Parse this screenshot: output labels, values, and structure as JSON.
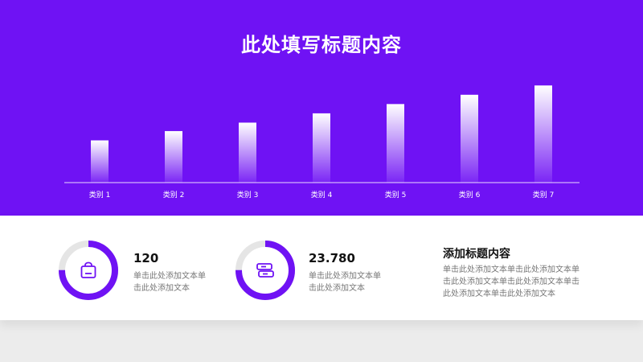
{
  "title": "此处填写标题内容",
  "colors": {
    "primary": "#6f12f4",
    "ring_track": "#e5e5e5",
    "text_dark": "#111111",
    "text_muted": "#777777"
  },
  "chart_data": {
    "type": "bar",
    "categories": [
      "类别 1",
      "类别 2",
      "类别 3",
      "类别 4",
      "类别 5",
      "类别 6",
      "类别 7"
    ],
    "values": [
      50,
      61,
      71,
      82,
      93,
      104,
      115
    ],
    "ylim": [
      0,
      120
    ],
    "grid": false
  },
  "stats": [
    {
      "value": "120",
      "desc": "单击此处添加文本单击此处添加文本",
      "icon": "shopping-bag-icon",
      "progress": 0.75
    },
    {
      "value": "23.780",
      "desc": "单击此处添加文本单击此处添加文本",
      "icon": "books-icon",
      "progress": 0.75
    }
  ],
  "side": {
    "title": "添加标题内容",
    "body": "单击此处添加文本单击此处添加文本单击此处添加文本单击此处添加文本单击此处添加文本单击此处添加文本"
  }
}
